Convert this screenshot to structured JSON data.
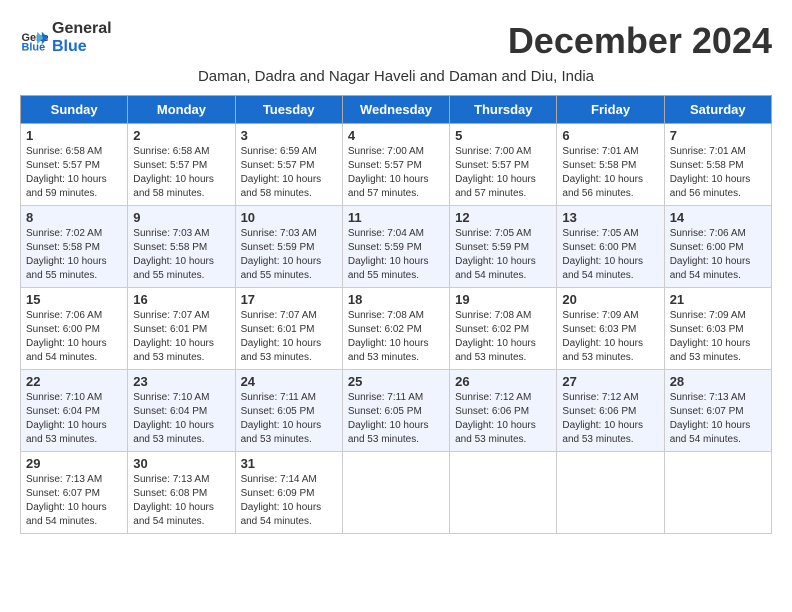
{
  "logo": {
    "text_general": "General",
    "text_blue": "Blue"
  },
  "title": "December 2024",
  "subtitle": "Daman, Dadra and Nagar Haveli and Daman and Diu, India",
  "days_of_week": [
    "Sunday",
    "Monday",
    "Tuesday",
    "Wednesday",
    "Thursday",
    "Friday",
    "Saturday"
  ],
  "weeks": [
    [
      {
        "day": "1",
        "sunrise": "Sunrise: 6:58 AM",
        "sunset": "Sunset: 5:57 PM",
        "daylight": "Daylight: 10 hours and 59 minutes."
      },
      {
        "day": "2",
        "sunrise": "Sunrise: 6:58 AM",
        "sunset": "Sunset: 5:57 PM",
        "daylight": "Daylight: 10 hours and 58 minutes."
      },
      {
        "day": "3",
        "sunrise": "Sunrise: 6:59 AM",
        "sunset": "Sunset: 5:57 PM",
        "daylight": "Daylight: 10 hours and 58 minutes."
      },
      {
        "day": "4",
        "sunrise": "Sunrise: 7:00 AM",
        "sunset": "Sunset: 5:57 PM",
        "daylight": "Daylight: 10 hours and 57 minutes."
      },
      {
        "day": "5",
        "sunrise": "Sunrise: 7:00 AM",
        "sunset": "Sunset: 5:57 PM",
        "daylight": "Daylight: 10 hours and 57 minutes."
      },
      {
        "day": "6",
        "sunrise": "Sunrise: 7:01 AM",
        "sunset": "Sunset: 5:58 PM",
        "daylight": "Daylight: 10 hours and 56 minutes."
      },
      {
        "day": "7",
        "sunrise": "Sunrise: 7:01 AM",
        "sunset": "Sunset: 5:58 PM",
        "daylight": "Daylight: 10 hours and 56 minutes."
      }
    ],
    [
      {
        "day": "8",
        "sunrise": "Sunrise: 7:02 AM",
        "sunset": "Sunset: 5:58 PM",
        "daylight": "Daylight: 10 hours and 55 minutes."
      },
      {
        "day": "9",
        "sunrise": "Sunrise: 7:03 AM",
        "sunset": "Sunset: 5:58 PM",
        "daylight": "Daylight: 10 hours and 55 minutes."
      },
      {
        "day": "10",
        "sunrise": "Sunrise: 7:03 AM",
        "sunset": "Sunset: 5:59 PM",
        "daylight": "Daylight: 10 hours and 55 minutes."
      },
      {
        "day": "11",
        "sunrise": "Sunrise: 7:04 AM",
        "sunset": "Sunset: 5:59 PM",
        "daylight": "Daylight: 10 hours and 55 minutes."
      },
      {
        "day": "12",
        "sunrise": "Sunrise: 7:05 AM",
        "sunset": "Sunset: 5:59 PM",
        "daylight": "Daylight: 10 hours and 54 minutes."
      },
      {
        "day": "13",
        "sunrise": "Sunrise: 7:05 AM",
        "sunset": "Sunset: 6:00 PM",
        "daylight": "Daylight: 10 hours and 54 minutes."
      },
      {
        "day": "14",
        "sunrise": "Sunrise: 7:06 AM",
        "sunset": "Sunset: 6:00 PM",
        "daylight": "Daylight: 10 hours and 54 minutes."
      }
    ],
    [
      {
        "day": "15",
        "sunrise": "Sunrise: 7:06 AM",
        "sunset": "Sunset: 6:00 PM",
        "daylight": "Daylight: 10 hours and 54 minutes."
      },
      {
        "day": "16",
        "sunrise": "Sunrise: 7:07 AM",
        "sunset": "Sunset: 6:01 PM",
        "daylight": "Daylight: 10 hours and 53 minutes."
      },
      {
        "day": "17",
        "sunrise": "Sunrise: 7:07 AM",
        "sunset": "Sunset: 6:01 PM",
        "daylight": "Daylight: 10 hours and 53 minutes."
      },
      {
        "day": "18",
        "sunrise": "Sunrise: 7:08 AM",
        "sunset": "Sunset: 6:02 PM",
        "daylight": "Daylight: 10 hours and 53 minutes."
      },
      {
        "day": "19",
        "sunrise": "Sunrise: 7:08 AM",
        "sunset": "Sunset: 6:02 PM",
        "daylight": "Daylight: 10 hours and 53 minutes."
      },
      {
        "day": "20",
        "sunrise": "Sunrise: 7:09 AM",
        "sunset": "Sunset: 6:03 PM",
        "daylight": "Daylight: 10 hours and 53 minutes."
      },
      {
        "day": "21",
        "sunrise": "Sunrise: 7:09 AM",
        "sunset": "Sunset: 6:03 PM",
        "daylight": "Daylight: 10 hours and 53 minutes."
      }
    ],
    [
      {
        "day": "22",
        "sunrise": "Sunrise: 7:10 AM",
        "sunset": "Sunset: 6:04 PM",
        "daylight": "Daylight: 10 hours and 53 minutes."
      },
      {
        "day": "23",
        "sunrise": "Sunrise: 7:10 AM",
        "sunset": "Sunset: 6:04 PM",
        "daylight": "Daylight: 10 hours and 53 minutes."
      },
      {
        "day": "24",
        "sunrise": "Sunrise: 7:11 AM",
        "sunset": "Sunset: 6:05 PM",
        "daylight": "Daylight: 10 hours and 53 minutes."
      },
      {
        "day": "25",
        "sunrise": "Sunrise: 7:11 AM",
        "sunset": "Sunset: 6:05 PM",
        "daylight": "Daylight: 10 hours and 53 minutes."
      },
      {
        "day": "26",
        "sunrise": "Sunrise: 7:12 AM",
        "sunset": "Sunset: 6:06 PM",
        "daylight": "Daylight: 10 hours and 53 minutes."
      },
      {
        "day": "27",
        "sunrise": "Sunrise: 7:12 AM",
        "sunset": "Sunset: 6:06 PM",
        "daylight": "Daylight: 10 hours and 53 minutes."
      },
      {
        "day": "28",
        "sunrise": "Sunrise: 7:13 AM",
        "sunset": "Sunset: 6:07 PM",
        "daylight": "Daylight: 10 hours and 54 minutes."
      }
    ],
    [
      {
        "day": "29",
        "sunrise": "Sunrise: 7:13 AM",
        "sunset": "Sunset: 6:07 PM",
        "daylight": "Daylight: 10 hours and 54 minutes."
      },
      {
        "day": "30",
        "sunrise": "Sunrise: 7:13 AM",
        "sunset": "Sunset: 6:08 PM",
        "daylight": "Daylight: 10 hours and 54 minutes."
      },
      {
        "day": "31",
        "sunrise": "Sunrise: 7:14 AM",
        "sunset": "Sunset: 6:09 PM",
        "daylight": "Daylight: 10 hours and 54 minutes."
      },
      null,
      null,
      null,
      null
    ]
  ]
}
